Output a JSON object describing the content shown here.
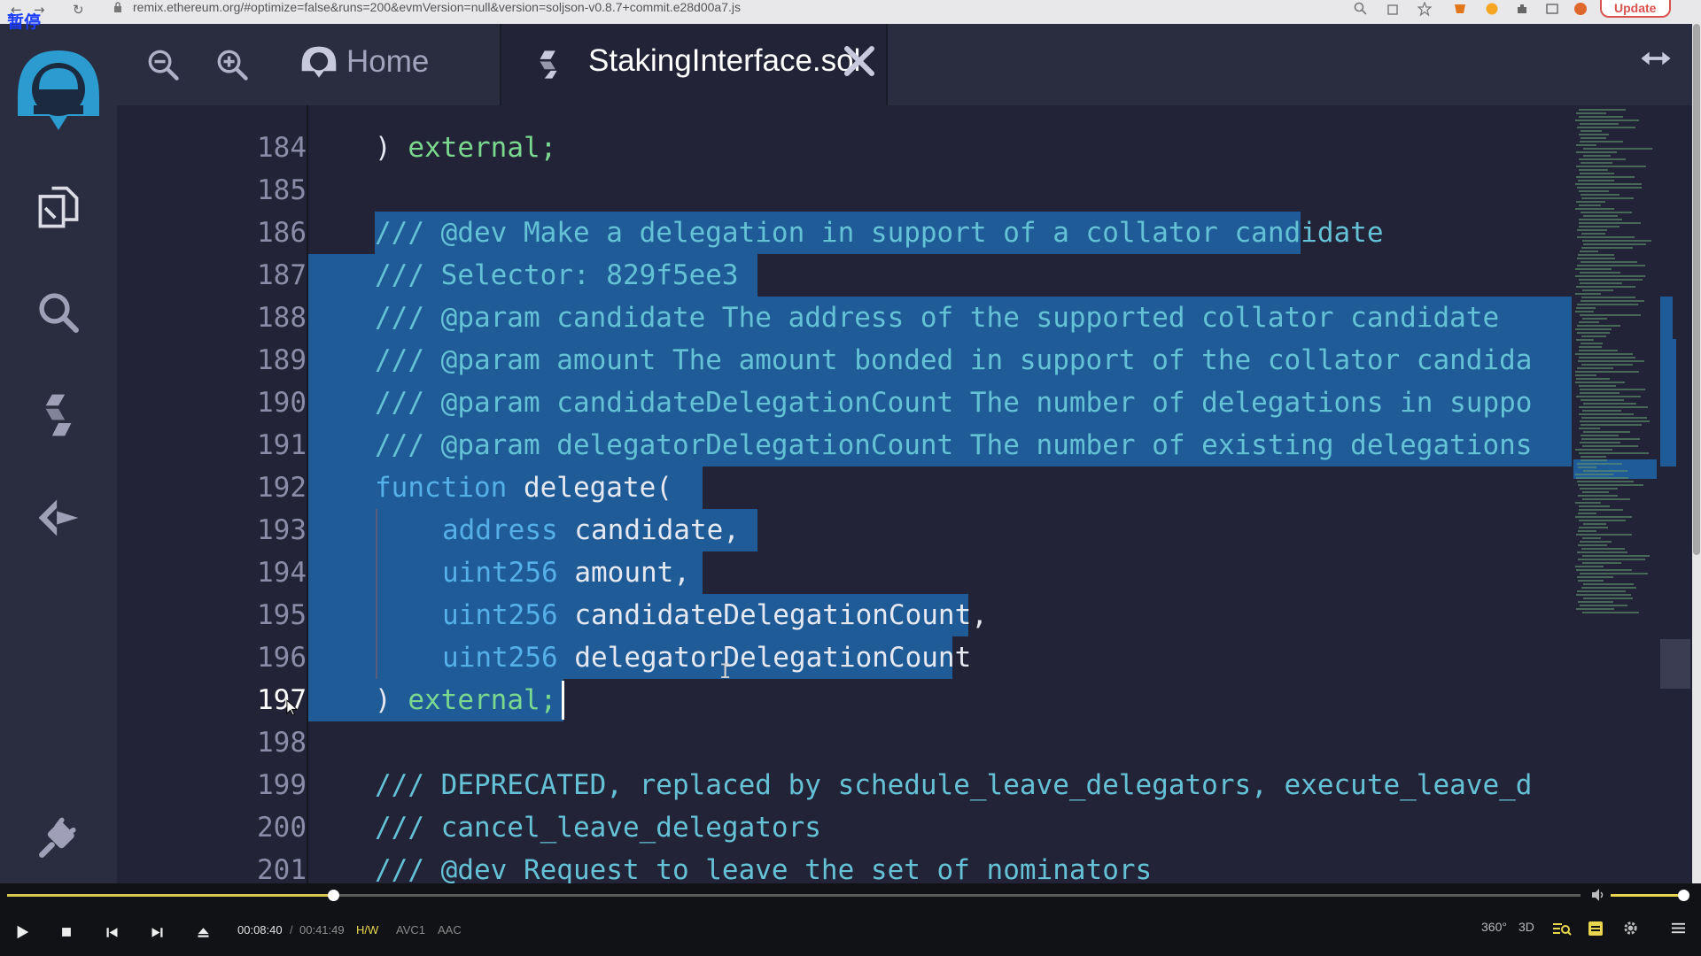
{
  "browser": {
    "url": "remix.ethereum.org/#optimize=false&runs=200&evmVersion=null&version=soljson-v0.8.7+commit.e28d00a7.js",
    "update_label": "Update"
  },
  "overlay": {
    "pause_label": "暂停"
  },
  "header": {
    "home_tab_label": "Home",
    "file_tab_label": "StakingInterface.sol"
  },
  "editor": {
    "line_numbers": [
      "184",
      "185",
      "186",
      "187",
      "188",
      "189",
      "190",
      "191",
      "192",
      "193",
      "194",
      "195",
      "196",
      "197",
      "198",
      "199",
      "200",
      "201"
    ],
    "active_line": "197",
    "lines": {
      "l184_paren": ")",
      "l184_kw": "external;",
      "l186": "/// @dev Make a delegation in support of a collator candidate",
      "l187": "/// Selector: 829f5ee3",
      "l188": "/// @param candidate The address of the supported collator candidate",
      "l189": "/// @param amount The amount bonded in support of the collator candida",
      "l190": "/// @param candidateDelegationCount The number of delegations in suppo",
      "l191": "/// @param delegatorDelegationCount The number of existing delegations",
      "l192_kw": "function",
      "l192_rest": "delegate(",
      "l193_type": "address",
      "l193_name": "candidate,",
      "l194_type": "uint256",
      "l194_name": "amount,",
      "l195_type": "uint256",
      "l195_name": "candidateDelegationCount,",
      "l196_type": "uint256",
      "l196_name": "delegatorDelegationCount",
      "l197_paren": ")",
      "l197_kw": "external;",
      "l199": "/// DEPRECATED, replaced by schedule_leave_delegators, execute_leave_d",
      "l200": "/// cancel_leave_delegators",
      "l201": "/// @dev Request to leave the set of nominators"
    }
  },
  "player": {
    "time_current": "00:08:40",
    "time_separator": "/",
    "time_total": "00:41:49",
    "playback_progress": 0.207,
    "volume_level": 1.0,
    "tags": [
      "H/W",
      "AVC1",
      "AAC"
    ],
    "right_labels": {
      "vr": "360°",
      "stereo": "3D"
    }
  },
  "colors": {
    "app_bg": "#222336",
    "sidebar_bg": "#2a2c3f",
    "selection": "#1f5c97",
    "comment": "#65c2d6",
    "keyword": "#56b0e8",
    "accent_logo": "#2b9bd0",
    "player_accent": "#e8d64e"
  }
}
